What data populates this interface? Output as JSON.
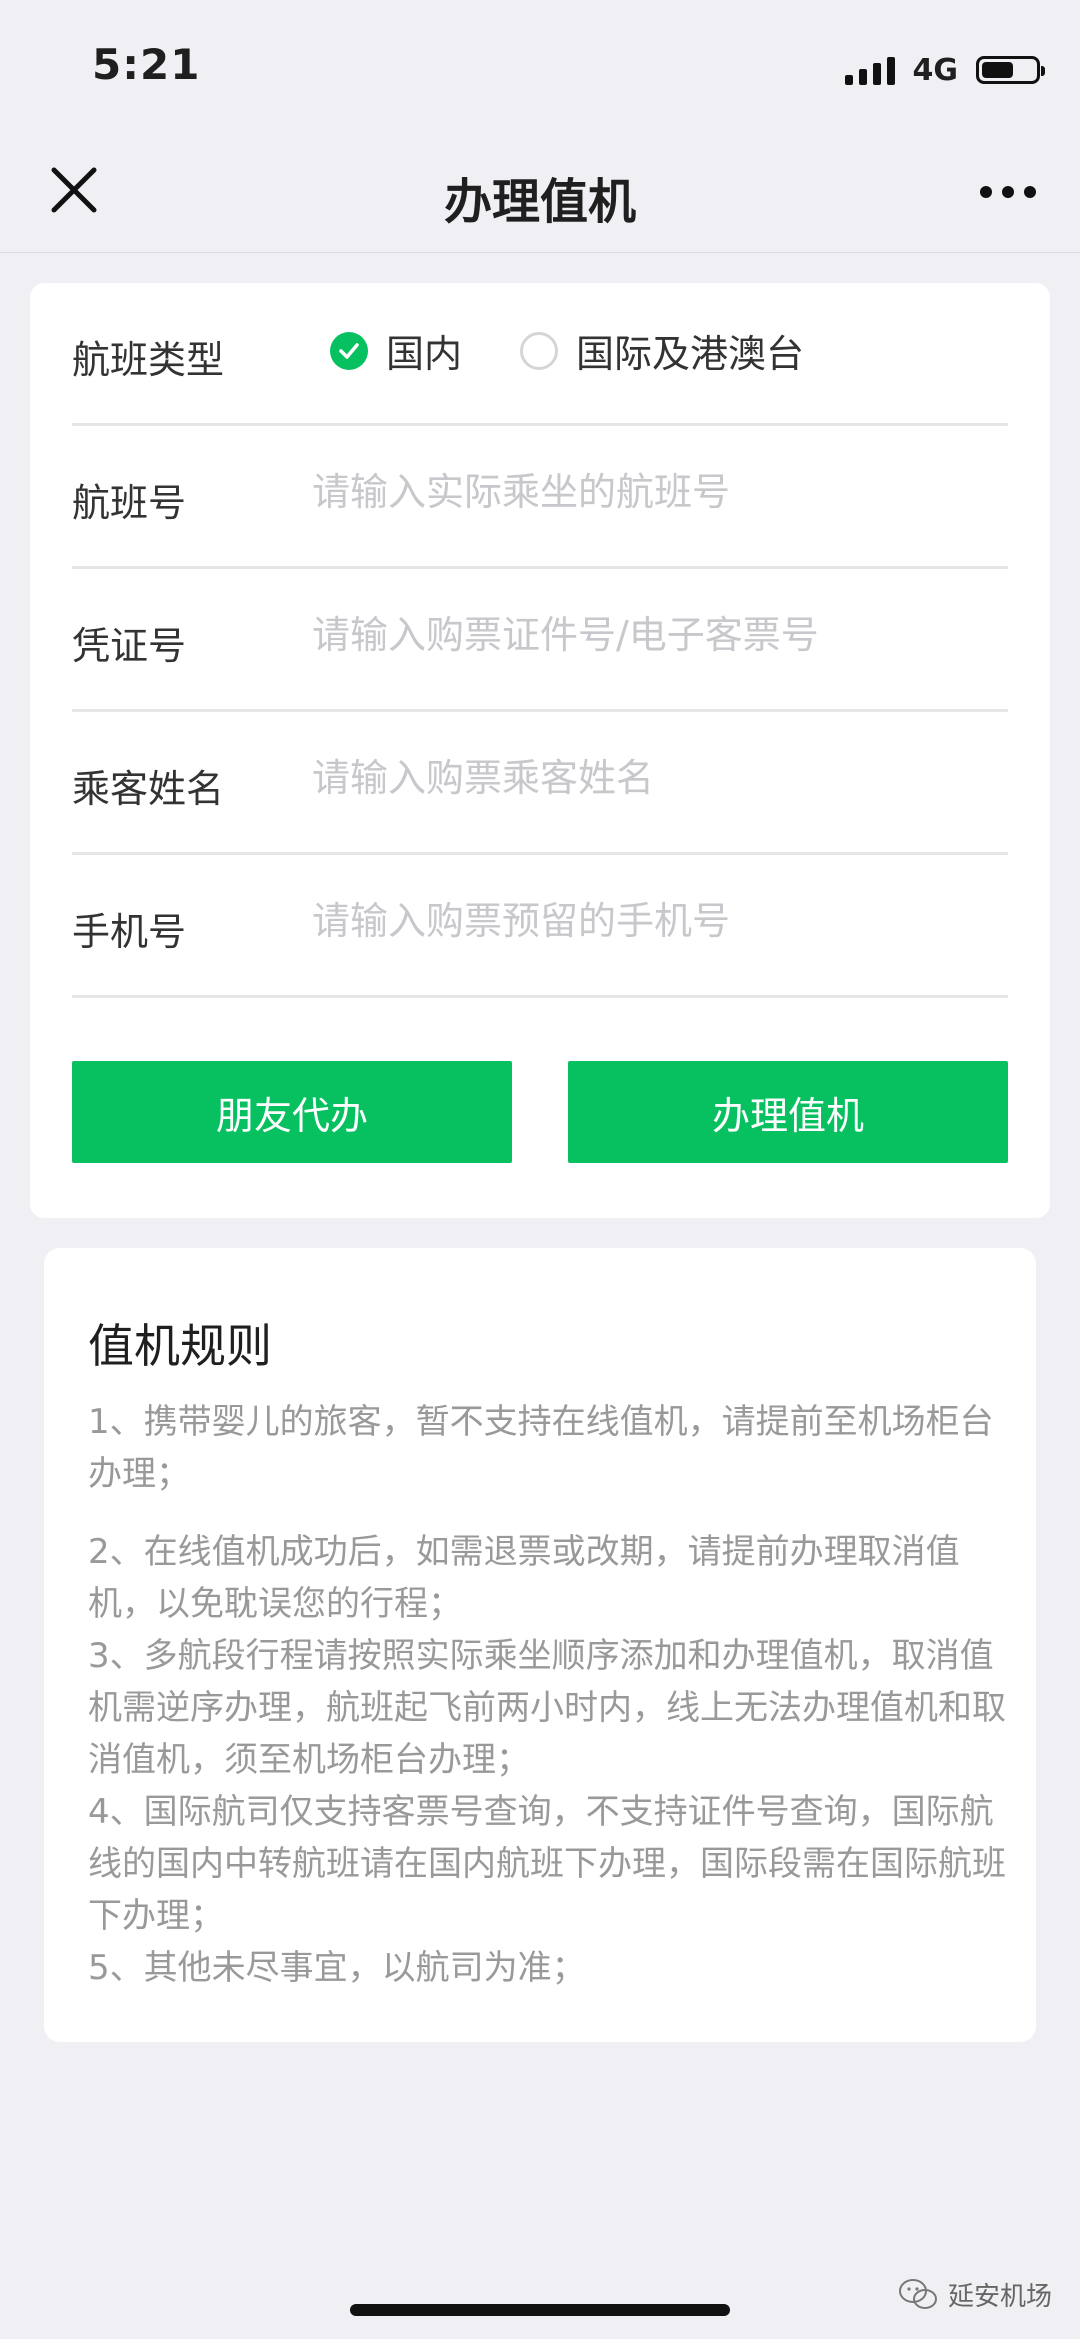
{
  "status_bar": {
    "time": "5:21",
    "network": "4G",
    "battery_level": 0.6
  },
  "nav": {
    "title": "办理值机",
    "close_icon": "close-icon",
    "more_icon": "more-icon"
  },
  "form": {
    "flight_type": {
      "label": "航班类型",
      "options": [
        "国内",
        "国际及港澳台"
      ],
      "selected": "国内"
    },
    "flight_no": {
      "label": "航班号",
      "placeholder": "请输入实际乘坐的航班号",
      "value": ""
    },
    "voucher": {
      "label": "凭证号",
      "placeholder": "请输入购票证件号/电子客票号",
      "value": ""
    },
    "passenger_name": {
      "label": "乘客姓名",
      "placeholder": "请输入购票乘客姓名",
      "value": ""
    },
    "phone": {
      "label": "手机号",
      "placeholder": "请输入购票预留的手机号",
      "value": ""
    },
    "buttons": {
      "friend_label": "朋友代办",
      "checkin_label": "办理值机"
    }
  },
  "rules": {
    "title": "值机规则",
    "items": [
      "1、携带婴儿的旅客，暂不支持在线值机，请提前至机场柜台办理；",
      "2、在线值机成功后，如需退票或改期，请提前办理取消值机，以免耽误您的行程；",
      "3、多航段行程请按照实际乘坐顺序添加和办理值机，取消值机需逆序办理，航班起飞前两小时内，线上无法办理值机和取消值机，须至机场柜台办理；",
      "4、国际航司仅支持客票号查询，不支持证件号查询，国际航线的国内中转航班请在国内航班下办理，国际段需在国际航班下办理；",
      "5、其他未尽事宜，以航司为准；"
    ]
  },
  "watermark": {
    "text": "延安机场"
  },
  "colors": {
    "accent": "#07c160",
    "background": "#efeff4",
    "card": "#ffffff",
    "placeholder": "#c7c7cc",
    "rule_text": "#999999"
  }
}
